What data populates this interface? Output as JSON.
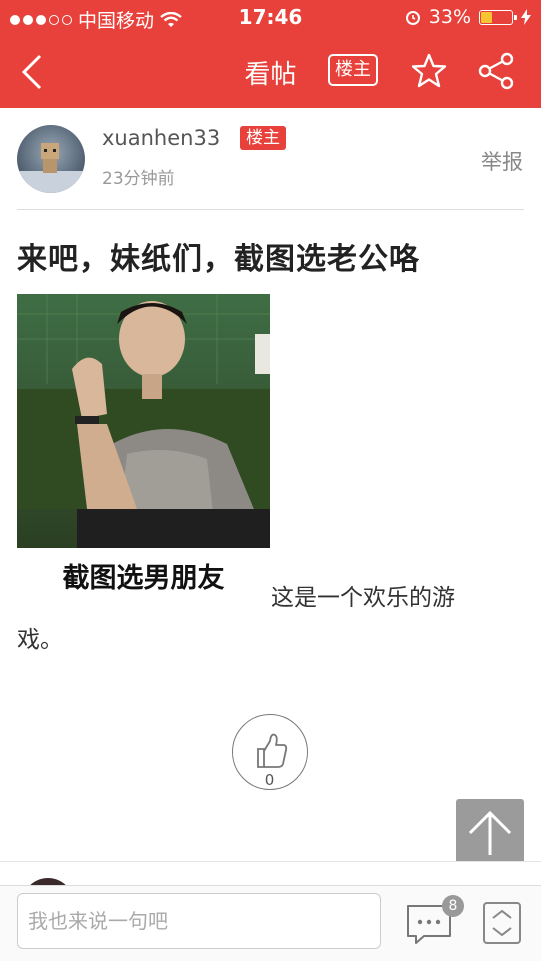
{
  "status": {
    "carrier": "中国移动",
    "time": "17:46",
    "battery": "33%",
    "battery_level": 0.33
  },
  "nav": {
    "title": "看帖",
    "louzhu_button": "楼主"
  },
  "author": {
    "username": "xuanhen33",
    "badge": "楼主",
    "time_ago": "23分钟前",
    "report": "举报"
  },
  "post": {
    "title": "来吧，妹纸们，截图选老公咯",
    "image_caption": "截图选男朋友",
    "text_line1": "这是一个欢乐的游",
    "text_line2": "戏。"
  },
  "like": {
    "count": "0"
  },
  "bottom": {
    "reply_placeholder": "我也来说一句吧",
    "comment_count": "8"
  }
}
